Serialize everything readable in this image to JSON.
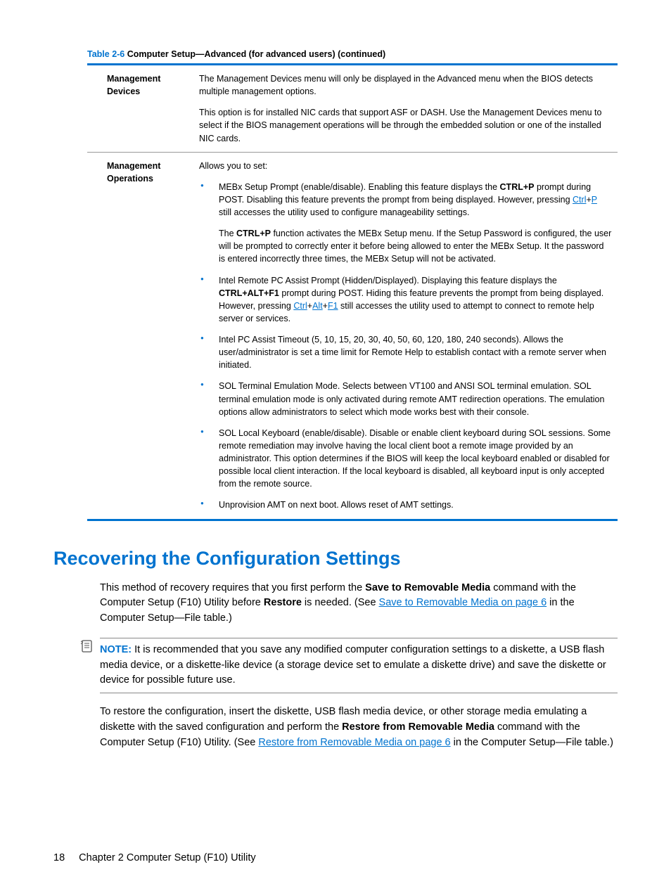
{
  "tableCaption": {
    "label": "Table 2-6",
    "title": "Computer Setup—Advanced (for advanced users) (continued)"
  },
  "rows": {
    "mgmtDevices": {
      "label": "Management Devices",
      "p1": "The Management Devices menu will only be displayed in the Advanced menu when the BIOS detects multiple management options.",
      "p2": "This option is for installed NIC cards that support ASF or DASH. Use the Management Devices menu to select if the BIOS management operations will be through the embedded solution or one of the installed NIC cards."
    },
    "mgmtOps": {
      "label": "Management Operations",
      "intro": "Allows you to set:",
      "b1": {
        "pre": "MEBx Setup Prompt (enable/disable). Enabling this feature displays the ",
        "bold1": "CTRL+P",
        "mid": " prompt during POST. Disabling this feature prevents the prompt from being displayed. However, pressing ",
        "link1": "Ctrl",
        "plus": "+",
        "link2": "P",
        "post": " still accesses the utility used to configure manageability settings.",
        "p2pre": "The ",
        "p2bold": "CTRL+P",
        "p2post": " function activates the MEBx Setup menu. If the Setup Password is configured, the user will be prompted to correctly enter it before being allowed to enter the MEBx Setup. It the password is entered incorrectly three times, the MEBx Setup will not be activated."
      },
      "b2": {
        "pre": "Intel Remote PC Assist Prompt (Hidden/Displayed). Displaying this feature displays the ",
        "bold1": "CTRL+ALT+F1",
        "mid": " prompt during POST. Hiding this feature prevents the prompt from being displayed. However, pressing ",
        "l1": "Ctrl",
        "l2": "Alt",
        "l3": "F1",
        "post": " still accesses the utility used to attempt to connect to remote help server or services."
      },
      "b3": "Intel PC Assist Timeout (5, 10, 15, 20, 30, 40, 50, 60, 120, 180, 240 seconds). Allows the user/administrator is set a time limit for Remote Help to establish contact with a remote server when initiated.",
      "b4": "SOL Terminal Emulation Mode. Selects between VT100 and ANSI SOL terminal emulation. SOL terminal emulation mode is only activated during remote AMT redirection operations. The emulation options allow administrators to select which mode works best with their console.",
      "b5": "SOL Local Keyboard (enable/disable). Disable or enable client keyboard during SOL sessions. Some remote remediation may involve having the local client boot a remote image provided by an administrator. This option determines if the BIOS will keep the local keyboard enabled or disabled for possible local client interaction. If the local keyboard is disabled, all keyboard input is only accepted from the remote source.",
      "b6": "Unprovision AMT on next boot. Allows reset of AMT settings."
    }
  },
  "heading": "Recovering the Configuration Settings",
  "p1": {
    "pre": "This method of recovery requires that you first perform the ",
    "b1": "Save to Removable Media",
    "mid": " command with the Computer Setup (F10) Utility before ",
    "b2": "Restore",
    "mid2": " is needed. (See ",
    "link": "Save to Removable Media on page 6",
    "post": " in the Computer Setup—File table.)"
  },
  "note": {
    "label": "NOTE:",
    "text": "It is recommended that you save any modified computer configuration settings to a diskette, a USB flash media device, or a diskette-like device (a storage device set to emulate a diskette drive) and save the diskette or device for possible future use."
  },
  "p2": {
    "pre": "To restore the configuration, insert the diskette, USB flash media device, or other storage media emulating a diskette with the saved configuration and perform the ",
    "b1": "Restore from Removable Media",
    "mid": " command with the Computer Setup (F10) Utility. (See ",
    "link": "Restore from Removable Media on page 6",
    "post": " in the Computer Setup—File table.)"
  },
  "footer": {
    "page": "18",
    "chapter": "Chapter 2   Computer Setup (F10) Utility"
  }
}
